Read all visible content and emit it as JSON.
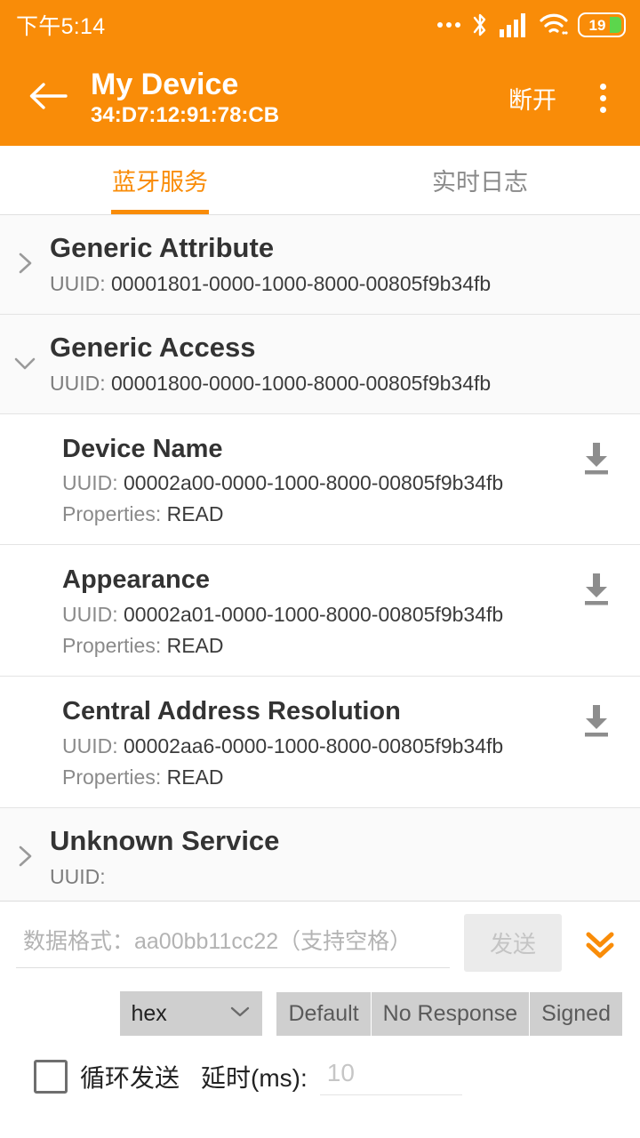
{
  "status_bar": {
    "time": "下午5:14",
    "battery_level": "19",
    "icons": [
      "more-dots-icon",
      "bluetooth-icon",
      "signal-icon",
      "wifi-icon",
      "battery-icon"
    ]
  },
  "app_bar": {
    "back_icon": "back-arrow-icon",
    "title": "My Device",
    "subtitle": "34:D7:12:91:78:CB",
    "disconnect_label": "断开",
    "overflow_icon": "overflow-menu-icon"
  },
  "tabs": [
    {
      "label": "蓝牙服务",
      "active": true
    },
    {
      "label": "实时日志",
      "active": false
    }
  ],
  "services": [
    {
      "name": "Generic Attribute",
      "uuid_label": "UUID: ",
      "uuid": "00001801-0000-1000-8000-00805f9b34fb",
      "expanded": false,
      "characteristics": []
    },
    {
      "name": "Generic Access",
      "uuid_label": "UUID: ",
      "uuid": "00001800-0000-1000-8000-00805f9b34fb",
      "expanded": true,
      "characteristics": [
        {
          "name": "Device Name",
          "uuid_label": "UUID: ",
          "uuid": "00002a00-0000-1000-8000-00805f9b34fb",
          "props_label": "Properties: ",
          "props": "READ",
          "action_icon": "download-icon"
        },
        {
          "name": "Appearance",
          "uuid_label": "UUID: ",
          "uuid": "00002a01-0000-1000-8000-00805f9b34fb",
          "props_label": "Properties: ",
          "props": "READ",
          "action_icon": "download-icon"
        },
        {
          "name": "Central Address Resolution",
          "uuid_label": "UUID: ",
          "uuid": "00002aa6-0000-1000-8000-00805f9b34fb",
          "props_label": "Properties: ",
          "props": "READ",
          "action_icon": "download-icon"
        }
      ]
    },
    {
      "name": "Unknown Service",
      "uuid_label": "UUID: ",
      "uuid": "",
      "expanded": false,
      "characteristics": []
    }
  ],
  "send_panel": {
    "input_value": "",
    "input_placeholder": "数据格式：aa00bb11cc22（支持空格）",
    "send_label": "发送",
    "expand_icon": "double-chevron-down-icon",
    "format_select": {
      "value": "hex",
      "caret_icon": "chevron-down-icon"
    },
    "write_modes": [
      "Default",
      "No Response",
      "Signed"
    ],
    "loop_checked": false,
    "loop_label": "循环发送",
    "delay_label": "延时(ms):",
    "delay_value": "",
    "delay_placeholder": "10"
  },
  "colors": {
    "accent": "#F98C08",
    "battery_fill": "#5CD64C",
    "panel_bg": "#FFFFFF",
    "service_bg": "#FAFAFA",
    "disabled_bg": "#EBEBEB",
    "segment_bg": "#CFCFCF"
  }
}
